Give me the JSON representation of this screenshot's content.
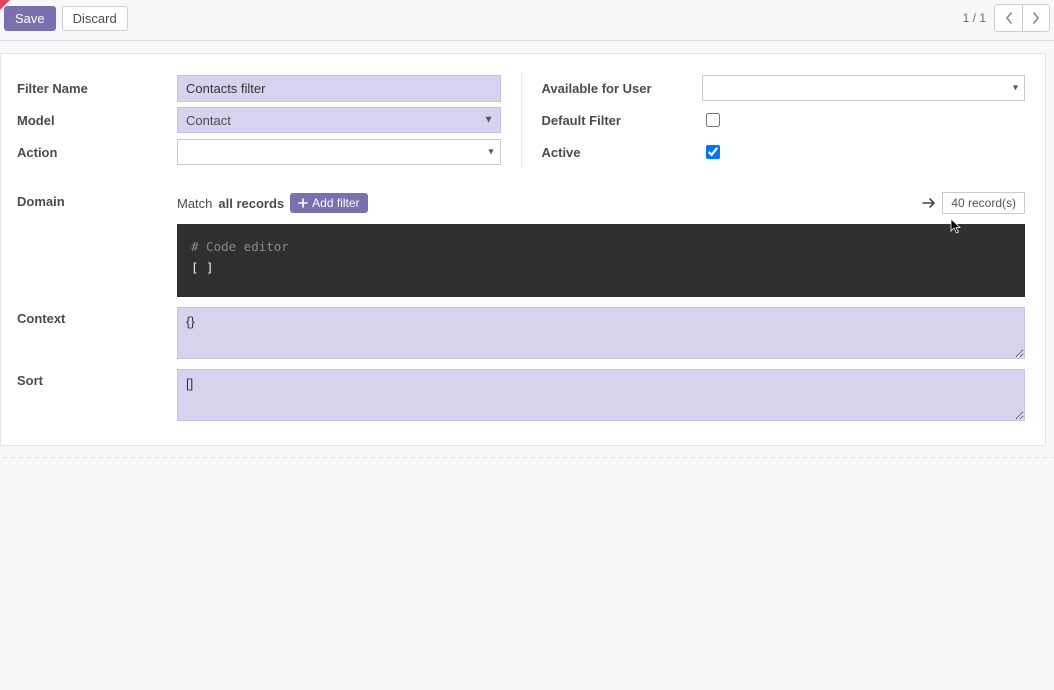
{
  "toolbar": {
    "save_label": "Save",
    "discard_label": "Discard",
    "pager": "1 / 1"
  },
  "fields": {
    "filter_name_label": "Filter Name",
    "filter_name_value": "Contacts filter",
    "model_label": "Model",
    "model_value": "Contact",
    "action_label": "Action",
    "action_value": "",
    "available_for_user_label": "Available for User",
    "available_for_user_value": "",
    "default_filter_label": "Default Filter",
    "active_label": "Active"
  },
  "domain": {
    "label": "Domain",
    "match_prefix": "Match ",
    "match_bold": "all records",
    "add_filter_label": " Add filter",
    "records_label": "40 record(s)",
    "code_comment": "# Code editor",
    "code_value": "[ ]"
  },
  "context": {
    "label": "Context",
    "value": "{}"
  },
  "sort": {
    "label": "Sort",
    "value": "[]"
  }
}
